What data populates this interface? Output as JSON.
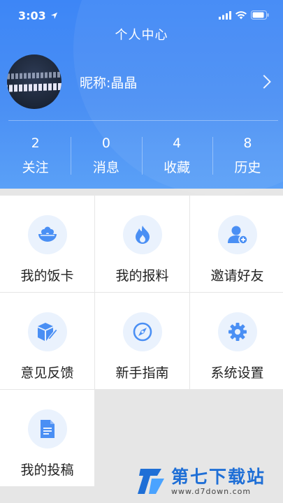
{
  "status_bar": {
    "time": "3:03"
  },
  "header": {
    "title": "个人中心",
    "nickname": "昵称:晶晶"
  },
  "stats": [
    {
      "value": "2",
      "label": "关注"
    },
    {
      "value": "0",
      "label": "消息"
    },
    {
      "value": "4",
      "label": "收藏"
    },
    {
      "value": "8",
      "label": "历史"
    }
  ],
  "grid": [
    {
      "label": "我的饭卡",
      "icon": "rice-bowl-icon"
    },
    {
      "label": "我的报料",
      "icon": "flame-icon"
    },
    {
      "label": "邀请好友",
      "icon": "add-user-icon"
    },
    {
      "label": "意见反馈",
      "icon": "feedback-box-icon"
    },
    {
      "label": "新手指南",
      "icon": "compass-icon"
    },
    {
      "label": "系统设置",
      "icon": "gear-icon"
    },
    {
      "label": "我的投稿",
      "icon": "document-icon"
    }
  ],
  "watermark": {
    "title": "第七下载站",
    "url": "www.d7down.com"
  },
  "colors": {
    "header": "#4a8ff4",
    "accent": "#4a8ff4",
    "icon_bg": "#eaf2fd"
  }
}
